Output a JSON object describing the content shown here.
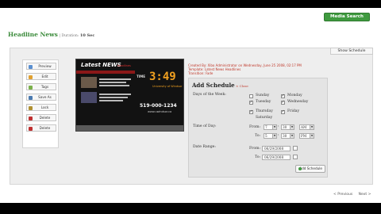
{
  "toolbar": {
    "media_search": "Media Search"
  },
  "header": {
    "title": "Headline News",
    "sep": "|",
    "duration_label": "Duration:",
    "duration": "10 Sec"
  },
  "show_schedule": "Show Schedule",
  "side_buttons": [
    "Preview",
    "Edit",
    "Tags",
    "Save As",
    "Lock",
    "Delete",
    "Delete"
  ],
  "thumbnail": {
    "logo": "Latest NEWS",
    "logo_sub": "headlines",
    "clock_label": "TIME",
    "clock": "3:49",
    "university": "University of Windsor",
    "phone": "519-000-1234",
    "website": "www.uwindsor.ca"
  },
  "meta": {
    "created": "Created By: Xibo Administrator on Wednesday, June 25 2008, 02:17 PM",
    "template": "Template: Latest News Headlines",
    "transition": "Transition: Fade"
  },
  "schedule": {
    "title": "Add Schedule",
    "close": "× Close",
    "days_label": "Days of the Week:",
    "days": [
      {
        "label": "Sunday",
        "checked": false
      },
      {
        "label": "Monday",
        "checked": true
      },
      {
        "label": "Tuesday",
        "checked": true
      },
      {
        "label": "Wednesday",
        "checked": true
      },
      {
        "label": "Thursday",
        "checked": true
      },
      {
        "label": "Friday",
        "checked": true
      },
      {
        "label": "Saturday",
        "checked": false
      }
    ],
    "time_label": "Time of Day:",
    "from_label": "From:",
    "to_label": "To:",
    "time_from": {
      "hour": "7",
      "minute": "30",
      "ampm": "AM"
    },
    "time_to": {
      "hour": "5",
      "minute": "30",
      "ampm": "PM"
    },
    "date_label": "Date Range:",
    "date_from": "06/29/2008",
    "date_to": "06/29/2008",
    "add_button": "Add Schedule"
  },
  "pager": {
    "prev": "< Previous",
    "next": "Next >"
  }
}
